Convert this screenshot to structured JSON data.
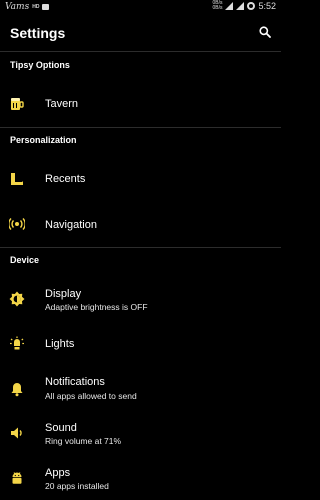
{
  "status_bar": {
    "carrier": "Vams",
    "hd": "HD",
    "speed_up": "0B/s",
    "speed_down": "0B/s",
    "time": "5:52"
  },
  "app_bar": {
    "title": "Settings"
  },
  "sections": [
    {
      "header": "Tipsy Options",
      "items": [
        {
          "title": "Tavern",
          "subtitle": ""
        }
      ]
    },
    {
      "header": "Personalization",
      "items": [
        {
          "title": "Recents",
          "subtitle": ""
        },
        {
          "title": "Navigation",
          "subtitle": ""
        }
      ]
    },
    {
      "header": "Device",
      "items": [
        {
          "title": "Display",
          "subtitle": "Adaptive brightness is OFF"
        },
        {
          "title": "Lights",
          "subtitle": ""
        },
        {
          "title": "Notifications",
          "subtitle": "All apps allowed to send"
        },
        {
          "title": "Sound",
          "subtitle": "Ring volume at 71%"
        },
        {
          "title": "Apps",
          "subtitle": "20 apps installed"
        }
      ]
    }
  ],
  "colors": {
    "accent": "#f3d548",
    "background": "#000000",
    "divider": "#2c2c2c"
  },
  "icons": [
    "search-icon",
    "tavern-icon",
    "recents-icon",
    "navigation-icon",
    "display-brightness-icon",
    "lights-icon",
    "notifications-bell-icon",
    "sound-volume-icon",
    "apps-android-icon"
  ]
}
